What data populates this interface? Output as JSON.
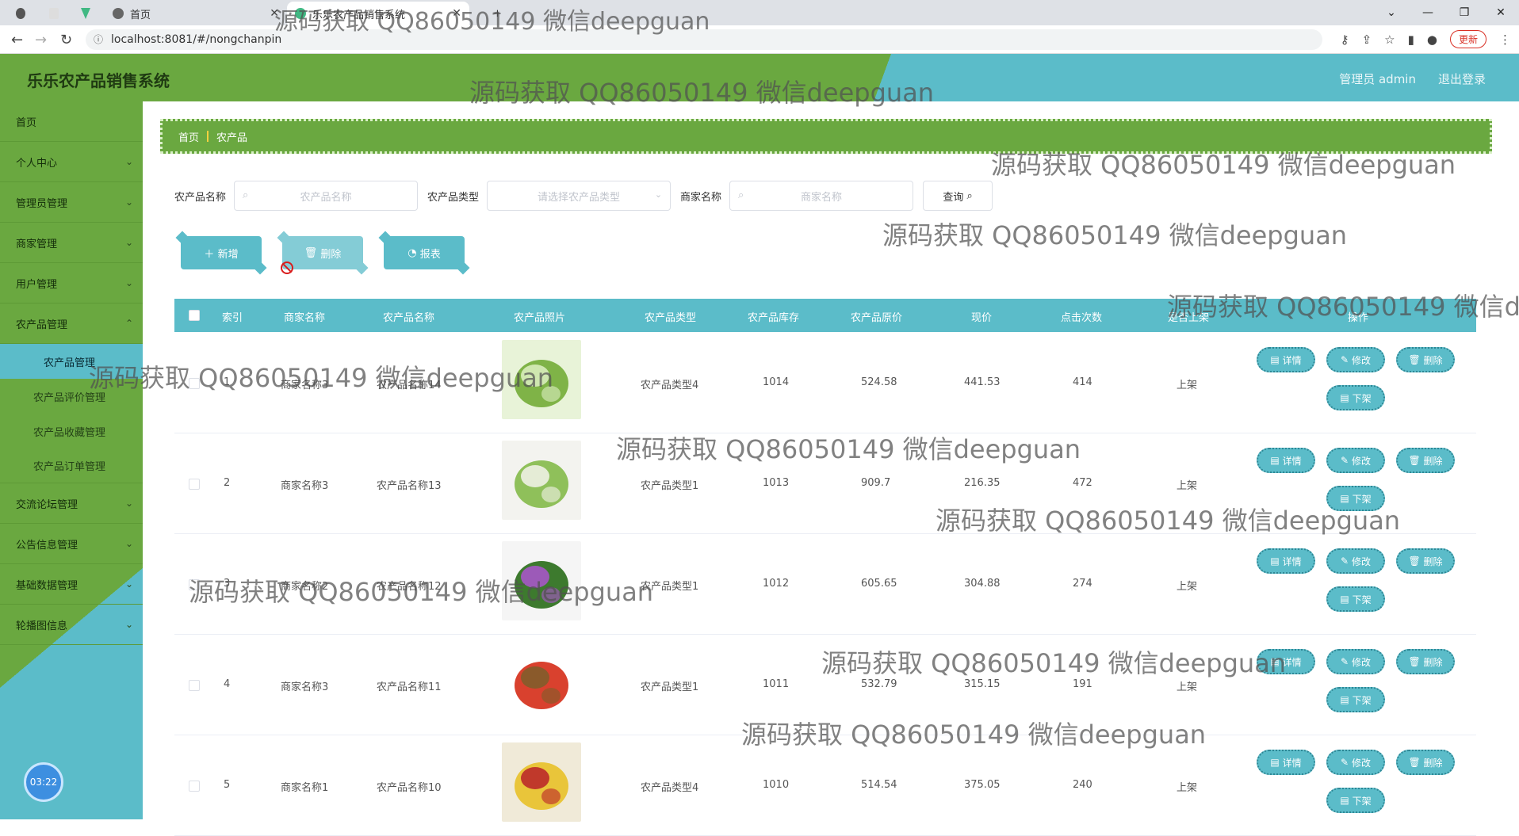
{
  "browser": {
    "tabs": [
      {
        "title": "首页"
      },
      {
        "title": "乐乐农产品销售系统"
      }
    ],
    "new_tab": "+",
    "url": "localhost:8081/#/nongchanpin",
    "update_label": "更新"
  },
  "app": {
    "brand": "乐乐农产品销售系统",
    "user": "管理员 admin",
    "logout": "退出登录"
  },
  "sidebar": {
    "items": [
      {
        "label": "首页",
        "chevron": false
      },
      {
        "label": "个人中心",
        "chevron": true
      },
      {
        "label": "管理员管理",
        "chevron": true
      },
      {
        "label": "商家管理",
        "chevron": true
      },
      {
        "label": "用户管理",
        "chevron": true
      },
      {
        "label": "农产品管理",
        "chevron": true
      }
    ],
    "subitems": [
      "农产品管理",
      "农产品评价管理",
      "农产品收藏管理",
      "农产品订单管理"
    ],
    "items_after": [
      {
        "label": "交流论坛管理"
      },
      {
        "label": "公告信息管理"
      },
      {
        "label": "基础数据管理"
      },
      {
        "label": "轮播图信息"
      }
    ],
    "clock": "03:22"
  },
  "breadcrumb": {
    "home": "首页",
    "current": "农产品"
  },
  "search": {
    "name_label": "农产品名称",
    "name_placeholder": "农产品名称",
    "type_label": "农产品类型",
    "type_placeholder": "请选择农产品类型",
    "shop_label": "商家名称",
    "shop_placeholder": "商家名称",
    "query_label": "查询"
  },
  "actions": {
    "add": "新增",
    "delete": "删除",
    "report": "报表"
  },
  "table": {
    "headers": [
      "索引",
      "商家名称",
      "农产品名称",
      "农产品照片",
      "农产品类型",
      "农产品库存",
      "农产品原价",
      "现价",
      "点击次数",
      "是否上架",
      "操作"
    ],
    "rows": [
      {
        "index": "1",
        "shop": "商家名称3",
        "name": "农产品名称14",
        "type": "农产品类型4",
        "stock": "1014",
        "orig": "524.58",
        "price": "441.53",
        "clicks": "414",
        "status": "上架"
      },
      {
        "index": "2",
        "shop": "商家名称3",
        "name": "农产品名称13",
        "type": "农产品类型1",
        "stock": "1013",
        "orig": "909.7",
        "price": "216.35",
        "clicks": "472",
        "status": "上架"
      },
      {
        "index": "3",
        "shop": "商家名称2",
        "name": "农产品名称12",
        "type": "农产品类型1",
        "stock": "1012",
        "orig": "605.65",
        "price": "304.88",
        "clicks": "274",
        "status": "上架"
      },
      {
        "index": "4",
        "shop": "商家名称3",
        "name": "农产品名称11",
        "type": "农产品类型1",
        "stock": "1011",
        "orig": "532.79",
        "price": "315.15",
        "clicks": "191",
        "status": "上架"
      },
      {
        "index": "5",
        "shop": "商家名称1",
        "name": "农产品名称10",
        "type": "农产品类型4",
        "stock": "1010",
        "orig": "514.54",
        "price": "375.05",
        "clicks": "240",
        "status": "上架"
      }
    ],
    "row_buttons": {
      "detail": "详情",
      "edit": "修改",
      "delete": "删除",
      "offshelf": "下架"
    }
  },
  "watermark": "源码获取 QQ86050149 微信deepguan",
  "colors": {
    "green": "#6aa840",
    "teal": "#5bbcc9"
  }
}
